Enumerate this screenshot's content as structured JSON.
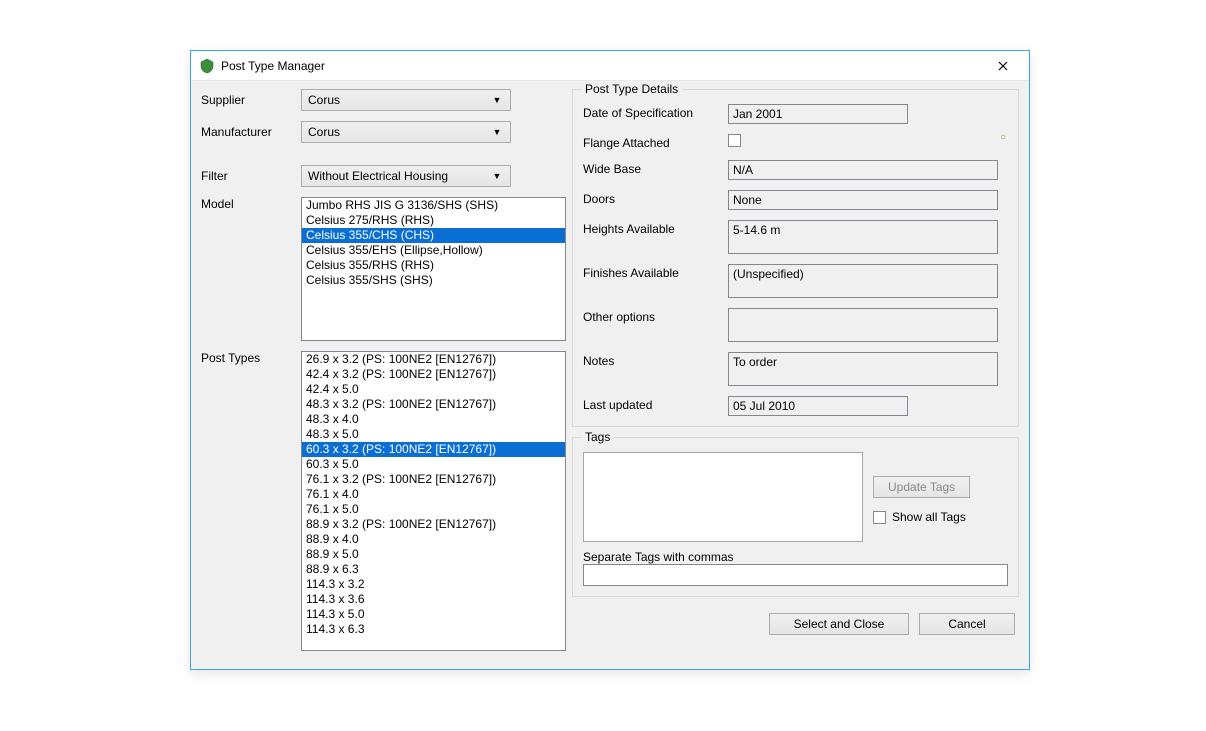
{
  "window": {
    "title": "Post Type Manager"
  },
  "left": {
    "supplier_label": "Supplier",
    "supplier_value": "Corus",
    "manufacturer_label": "Manufacturer",
    "manufacturer_value": "Corus",
    "filter_label": "Filter",
    "filter_value": "Without Electrical Housing",
    "model_label": "Model",
    "models": [
      "Jumbo RHS JIS G 3136/SHS (SHS)",
      "Celsius 275/RHS (RHS)",
      "Celsius 355/CHS (CHS)",
      "Celsius 355/EHS (Ellipse,Hollow)",
      "Celsius 355/RHS (RHS)",
      "Celsius 355/SHS (SHS)"
    ],
    "model_selected_index": 2,
    "post_types_label": "Post Types",
    "post_types": [
      "26.9 x 3.2 (PS: 100NE2 [EN12767])",
      "42.4 x 3.2 (PS: 100NE2 [EN12767])",
      "42.4 x 5.0",
      "48.3 x 3.2 (PS: 100NE2 [EN12767])",
      "48.3 x 4.0",
      "48.3 x 5.0",
      "60.3 x 3.2 (PS: 100NE2 [EN12767])",
      "60.3 x 5.0",
      "76.1 x 3.2 (PS: 100NE2 [EN12767])",
      "76.1 x 4.0",
      "76.1 x 5.0",
      "88.9 x 3.2 (PS: 100NE2 [EN12767])",
      "88.9 x 4.0",
      "88.9 x 5.0",
      "88.9 x 6.3",
      "114.3 x 3.2",
      "114.3 x 3.6",
      "114.3 x 5.0",
      "114.3 x 6.3"
    ],
    "post_type_selected_index": 6
  },
  "details": {
    "legend": "Post Type Details",
    "date_label": "Date of Specification",
    "date_value": "Jan 2001",
    "flange_label": "Flange Attached",
    "widebase_label": "Wide Base",
    "widebase_value": "N/A",
    "doors_label": "Doors",
    "doors_value": "None",
    "heights_label": "Heights Available",
    "heights_value": "5-14.6 m",
    "finishes_label": "Finishes Available",
    "finishes_value": "(Unspecified)",
    "other_label": "Other options",
    "other_value": "",
    "notes_label": "Notes",
    "notes_value": "To order",
    "updated_label": "Last updated",
    "updated_value": "05 Jul 2010"
  },
  "tags": {
    "legend": "Tags",
    "update_btn": "Update Tags",
    "show_all_label": "Show all Tags",
    "separate_label": "Separate Tags with commas"
  },
  "footer": {
    "select_close": "Select and Close",
    "cancel": "Cancel"
  }
}
